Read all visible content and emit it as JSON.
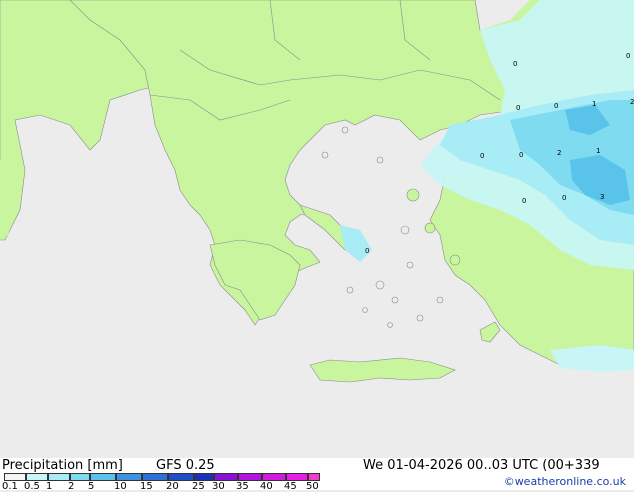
{
  "footer": {
    "title": "Precipitation [mm]",
    "model": "GFS 0.25",
    "valid_time": "We 01-04-2026 00..03 UTC (00+339",
    "credit": "©weatheronline.co.uk"
  },
  "legend": {
    "ticks": [
      "0.1",
      "0.5",
      "1",
      "2",
      "5",
      "10",
      "15",
      "20",
      "25",
      "30",
      "35",
      "40",
      "45",
      "50"
    ],
    "colors": [
      "#f5f5f5",
      "#c8f5f5",
      "#a8ecf5",
      "#7fdcf0",
      "#59c3ea",
      "#3d93e0",
      "#2e6fd8",
      "#1f4fc8",
      "#1a30b8",
      "#8a12d8",
      "#b414e0",
      "#d21ae0",
      "#e81ee8",
      "#f040c8"
    ]
  },
  "map": {
    "colors": {
      "sea": "#ececec",
      "land": "#c8f59e",
      "border": "#8a8a8a",
      "precip_light": "#c8f5f5",
      "precip_mid": "#a8ecf5",
      "precip_heavy": "#7fdcf0",
      "precip_max": "#59c3ea"
    },
    "values": [
      "0",
      "0",
      "1",
      "2",
      "0",
      "0",
      "0",
      "2",
      "1",
      "0",
      "0",
      "3",
      "0",
      "0"
    ]
  }
}
